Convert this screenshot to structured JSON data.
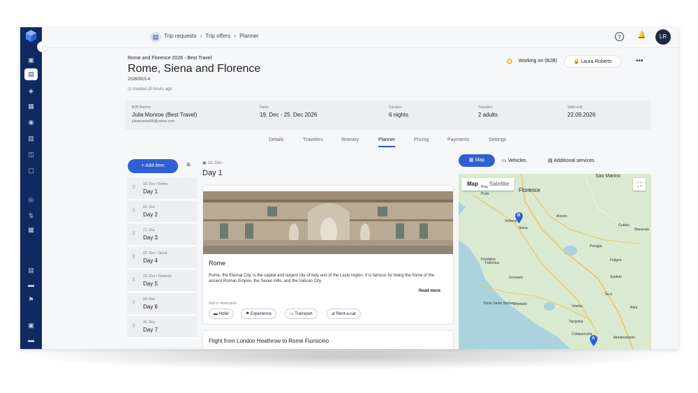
{
  "breadcrumbs": [
    "Trip requests",
    "Trip offers",
    "Planner"
  ],
  "user": {
    "initials": "LR",
    "owner": "Laura Roberts"
  },
  "trip": {
    "kicker": "Rome and Florence 2026 - Best Travel",
    "title": "Rome, Siena and Florence",
    "code": "20260915-4",
    "created": "created 20 hours ago",
    "status": "Working on (B2B)"
  },
  "info": {
    "partner_label": "B2B Partner",
    "partner": "Julia Monroe (Best Travel)",
    "partner_email": "juliamonroe95@yahoo.com",
    "dates_label": "Dates",
    "dates": "19. Dec - 25. Dec 2026",
    "duration_label": "Duration",
    "duration": "6 nights",
    "travelers_label": "Travelers",
    "travelers": "2 adults",
    "valid_label": "Valid until",
    "valid": "22.09.2026"
  },
  "tabs": [
    "Details",
    "Travelers",
    "Itinerary",
    "Planner",
    "Pricing",
    "Payments",
    "Settings"
  ],
  "add_item": "Add item",
  "days": [
    {
      "date": "19. Dec • Rome",
      "name": "Day 1"
    },
    {
      "date": "20. Dec",
      "name": "Day 2"
    },
    {
      "date": "21. Dec",
      "name": "Day 3"
    },
    {
      "date": "22. Dec • Siena",
      "name": "Day 4"
    },
    {
      "date": "23. Dec • Florence",
      "name": "Day 5"
    },
    {
      "date": "24. Dec",
      "name": "Day 6"
    },
    {
      "date": "25. Dec",
      "name": "Day 7"
    }
  ],
  "current_day": {
    "date": "19. Dec",
    "title": "Day 1"
  },
  "destination": {
    "name": "Rome",
    "description": "Rome, the Eternal City, is the capital and largest city of Italy and of the Lazio region. It is famous for being the home of the ancient Roman Empire, the Seven Hills, and the Vatican City.",
    "read_more": "Read more",
    "add_to": "Add to destination",
    "chips": [
      "Hotel",
      "Experience",
      "Transport",
      "Rent-a-car"
    ]
  },
  "flight": "Flight from London Heathrow to Rome Fiumicino",
  "map_tabs": [
    "Map",
    "Vehicles",
    "Additional services"
  ],
  "map_toggle": [
    "Map",
    "Satellite"
  ],
  "map_labels": [
    "Florence",
    "Siena",
    "Arezzo",
    "Perugia",
    "Grosseto",
    "Orbetello",
    "Terni",
    "Tarquinia",
    "Civitavecchia",
    "Viterbo",
    "Spoleto",
    "Gubbio",
    "Piombino",
    "Prato",
    "Pisa",
    "Volterra",
    "Follonica",
    "Foligno",
    "Porto Santo Stefano",
    "Monterotondo",
    "San Marino",
    "Macerata",
    "Rieti"
  ],
  "map_markers": [
    "B",
    "A"
  ],
  "colors": {
    "rail": "#0f2a63",
    "accent": "#2f5fd3",
    "status": "#f0c419"
  }
}
